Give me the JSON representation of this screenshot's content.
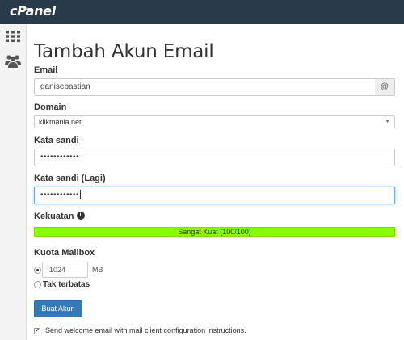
{
  "app": {
    "logo": "cPanel"
  },
  "sidebar": {
    "icons": [
      "grid-icon",
      "users-icon"
    ]
  },
  "form": {
    "title": "Tambah Akun Email",
    "email": {
      "label": "Email",
      "value": "ganisebastian",
      "addon": "@"
    },
    "domain": {
      "label": "Domain",
      "selected": "klikmania.net"
    },
    "password": {
      "label": "Kata sandi",
      "value": "••••••••••••"
    },
    "password_again": {
      "label": "Kata sandi (Lagi)",
      "value": "••••••••••••"
    },
    "strength": {
      "label": "Kekuatan",
      "info_glyph": "i",
      "text": "Sangat Kuat (100/100)",
      "score": 100,
      "color": "#88ff00"
    },
    "quota": {
      "label": "Kuota Mailbox",
      "value": "1024",
      "unit": "MB",
      "unlimited_label": "Tak terbatas",
      "selected": "limited"
    },
    "submit_label": "Buat Akun",
    "welcome_email": {
      "checked": true,
      "label": "Send welcome email with mail client configuration instructions."
    }
  },
  "colors": {
    "topbar": "#293a4a",
    "primary_button": "#337ab7",
    "strength_bar": "#88ff00"
  }
}
